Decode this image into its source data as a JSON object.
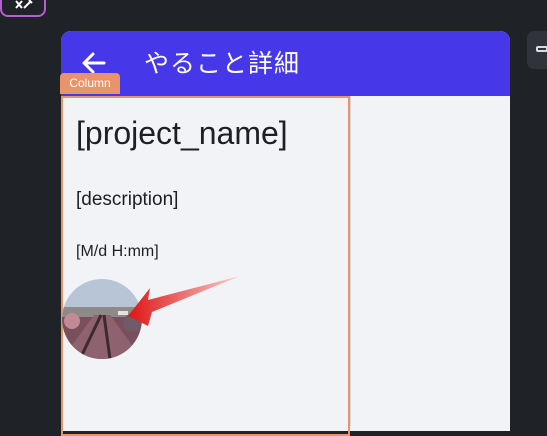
{
  "app_bar": {
    "title": "やること詳細",
    "back_icon": "arrow-left-icon"
  },
  "editor": {
    "widget_badge": "Column",
    "tool_icon": "wrench-icon",
    "side_tool_icon": "panel-icon"
  },
  "content": {
    "project_name": "[project_name]",
    "description": "[description]",
    "datetime": "[M/d H:mm]"
  },
  "annotation": {
    "arrow_color": "#e02020"
  },
  "colors": {
    "app_bar": "#4637e8",
    "badge": "#e7946a",
    "background": "#f1f3f7"
  }
}
